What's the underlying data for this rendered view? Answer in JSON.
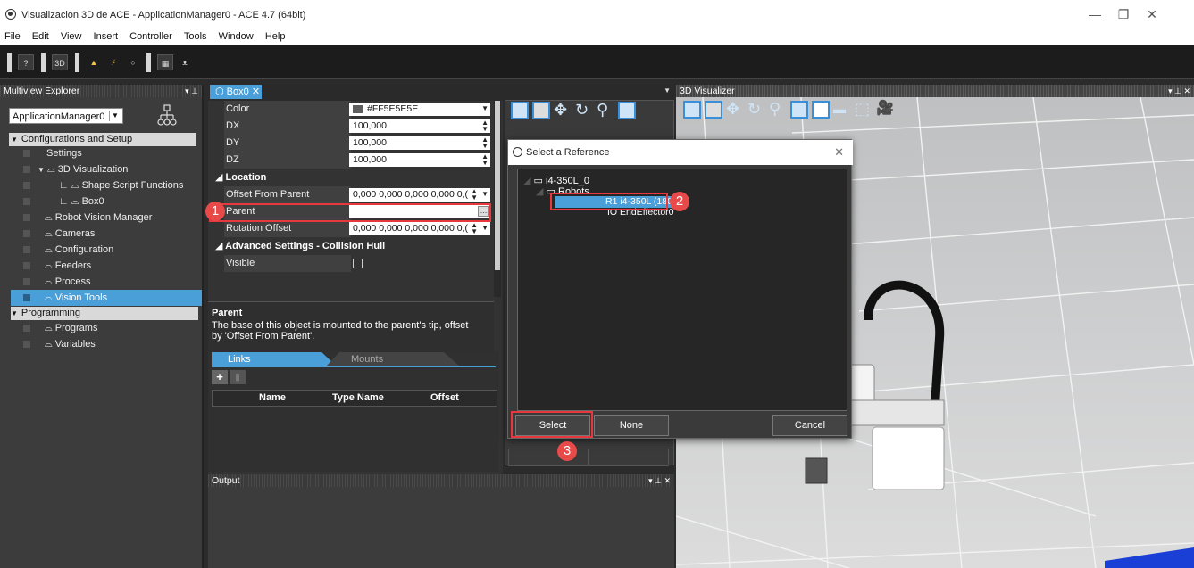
{
  "window": {
    "title": "Visualizacion 3D de ACE - ApplicationManager0 - ACE 4.7 (64bit)"
  },
  "menu": [
    "File",
    "Edit",
    "View",
    "Insert",
    "Controller",
    "Tools",
    "Window",
    "Help"
  ],
  "explorer": {
    "header": "Multiview Explorer",
    "combo": "ApplicationManager0",
    "cat_config": "Configurations and Setup",
    "items": [
      "Settings",
      "3D Visualization",
      "Shape Script Functions",
      "Box0",
      "Robot Vision Manager",
      "Cameras",
      "Configuration",
      "Feeders",
      "Process",
      "Vision Tools"
    ],
    "cat_programming": "Programming",
    "prog_items": [
      "Programs",
      "Variables"
    ]
  },
  "doc_tab": "Box0",
  "properties": {
    "rows": [
      {
        "label": "Color",
        "value": "#FF5E5E5E"
      },
      {
        "label": "DX",
        "value": "100,000"
      },
      {
        "label": "DY",
        "value": "100,000"
      },
      {
        "label": "DZ",
        "value": "100,000"
      }
    ],
    "section_location": "Location",
    "offset_label": "Offset From Parent",
    "offset_value": "0,000 0,000 0,000 0,000 0,(",
    "parent_label": "Parent",
    "parent_value": "",
    "rotation_label": "Rotation Offset",
    "rotation_value": "0,000 0,000 0,000 0,000 0,(",
    "section_advanced": "Advanced Settings - Collision Hull",
    "visible_label": "Visible",
    "desc_title": "Parent",
    "desc_text": "The base of this object is mounted to the parent's tip, offset by 'Offset From Parent'.",
    "tab_links": "Links",
    "tab_mounts": "Mounts",
    "col_name": "Name",
    "col_type": "Type Name",
    "col_offset": "Offset"
  },
  "output": {
    "header": "Output"
  },
  "visualizer": {
    "header": "3D Visualizer"
  },
  "dialog": {
    "title": "Select a Reference",
    "root": "i4-350L_0",
    "robots": "Robots",
    "robot_item": "R1 i4-350L (180 mm)",
    "io_item": "IO EndEffector0",
    "select": "Select",
    "none": "None",
    "cancel": "Cancel"
  },
  "badges": [
    "1",
    "2",
    "3"
  ],
  "colors": {
    "accent": "#4a9fd8",
    "highlight_red": "#e8383d",
    "badge_red": "#e84a4a"
  }
}
